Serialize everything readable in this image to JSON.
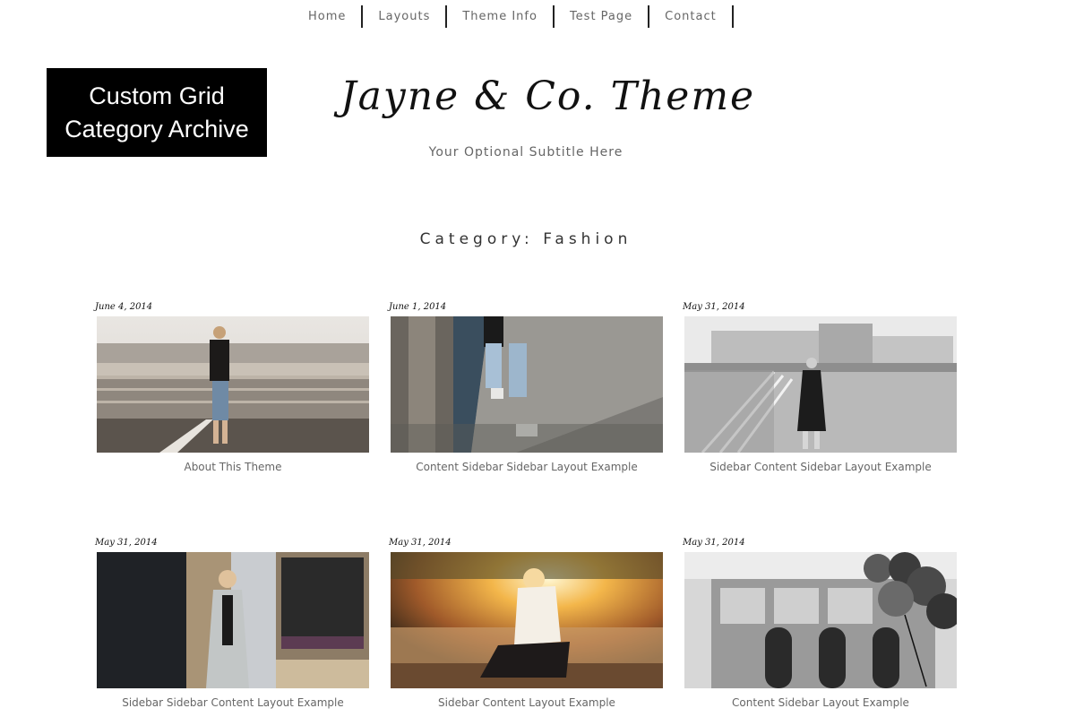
{
  "nav": {
    "items": [
      {
        "label": "Home"
      },
      {
        "label": "Layouts"
      },
      {
        "label": "Theme Info"
      },
      {
        "label": "Test Page"
      },
      {
        "label": "Contact"
      }
    ]
  },
  "label_box": {
    "line1": "Custom Grid",
    "line2": "Category Archive"
  },
  "header": {
    "title": "Jayne & Co. Theme",
    "subtitle": "Your Optional Subtitle Here"
  },
  "category": {
    "heading": "Category: Fashion"
  },
  "posts": [
    {
      "date": "June 4, 2014",
      "title": "About This Theme"
    },
    {
      "date": "June 1, 2014",
      "title": "Content Sidebar Sidebar Layout Example"
    },
    {
      "date": "May 31, 2014",
      "title": "Sidebar Content Sidebar Layout Example"
    },
    {
      "date": "May 31, 2014",
      "title": "Sidebar Sidebar Content Layout Example"
    },
    {
      "date": "May 31, 2014",
      "title": "Sidebar Content Layout Example"
    },
    {
      "date": "May 31, 2014",
      "title": "Content Sidebar Layout Example"
    }
  ]
}
